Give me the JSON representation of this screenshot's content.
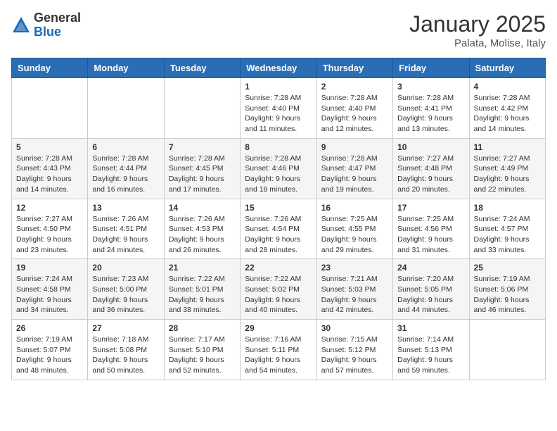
{
  "header": {
    "logo_general": "General",
    "logo_blue": "Blue",
    "month_title": "January 2025",
    "location": "Palata, Molise, Italy"
  },
  "days_of_week": [
    "Sunday",
    "Monday",
    "Tuesday",
    "Wednesday",
    "Thursday",
    "Friday",
    "Saturday"
  ],
  "weeks": [
    [
      {
        "day": "",
        "info": ""
      },
      {
        "day": "",
        "info": ""
      },
      {
        "day": "",
        "info": ""
      },
      {
        "day": "1",
        "info": "Sunrise: 7:28 AM\nSunset: 4:40 PM\nDaylight: 9 hours\nand 11 minutes."
      },
      {
        "day": "2",
        "info": "Sunrise: 7:28 AM\nSunset: 4:40 PM\nDaylight: 9 hours\nand 12 minutes."
      },
      {
        "day": "3",
        "info": "Sunrise: 7:28 AM\nSunset: 4:41 PM\nDaylight: 9 hours\nand 13 minutes."
      },
      {
        "day": "4",
        "info": "Sunrise: 7:28 AM\nSunset: 4:42 PM\nDaylight: 9 hours\nand 14 minutes."
      }
    ],
    [
      {
        "day": "5",
        "info": "Sunrise: 7:28 AM\nSunset: 4:43 PM\nDaylight: 9 hours\nand 14 minutes."
      },
      {
        "day": "6",
        "info": "Sunrise: 7:28 AM\nSunset: 4:44 PM\nDaylight: 9 hours\nand 16 minutes."
      },
      {
        "day": "7",
        "info": "Sunrise: 7:28 AM\nSunset: 4:45 PM\nDaylight: 9 hours\nand 17 minutes."
      },
      {
        "day": "8",
        "info": "Sunrise: 7:28 AM\nSunset: 4:46 PM\nDaylight: 9 hours\nand 18 minutes."
      },
      {
        "day": "9",
        "info": "Sunrise: 7:28 AM\nSunset: 4:47 PM\nDaylight: 9 hours\nand 19 minutes."
      },
      {
        "day": "10",
        "info": "Sunrise: 7:27 AM\nSunset: 4:48 PM\nDaylight: 9 hours\nand 20 minutes."
      },
      {
        "day": "11",
        "info": "Sunrise: 7:27 AM\nSunset: 4:49 PM\nDaylight: 9 hours\nand 22 minutes."
      }
    ],
    [
      {
        "day": "12",
        "info": "Sunrise: 7:27 AM\nSunset: 4:50 PM\nDaylight: 9 hours\nand 23 minutes."
      },
      {
        "day": "13",
        "info": "Sunrise: 7:26 AM\nSunset: 4:51 PM\nDaylight: 9 hours\nand 24 minutes."
      },
      {
        "day": "14",
        "info": "Sunrise: 7:26 AM\nSunset: 4:53 PM\nDaylight: 9 hours\nand 26 minutes."
      },
      {
        "day": "15",
        "info": "Sunrise: 7:26 AM\nSunset: 4:54 PM\nDaylight: 9 hours\nand 28 minutes."
      },
      {
        "day": "16",
        "info": "Sunrise: 7:25 AM\nSunset: 4:55 PM\nDaylight: 9 hours\nand 29 minutes."
      },
      {
        "day": "17",
        "info": "Sunrise: 7:25 AM\nSunset: 4:56 PM\nDaylight: 9 hours\nand 31 minutes."
      },
      {
        "day": "18",
        "info": "Sunrise: 7:24 AM\nSunset: 4:57 PM\nDaylight: 9 hours\nand 33 minutes."
      }
    ],
    [
      {
        "day": "19",
        "info": "Sunrise: 7:24 AM\nSunset: 4:58 PM\nDaylight: 9 hours\nand 34 minutes."
      },
      {
        "day": "20",
        "info": "Sunrise: 7:23 AM\nSunset: 5:00 PM\nDaylight: 9 hours\nand 36 minutes."
      },
      {
        "day": "21",
        "info": "Sunrise: 7:22 AM\nSunset: 5:01 PM\nDaylight: 9 hours\nand 38 minutes."
      },
      {
        "day": "22",
        "info": "Sunrise: 7:22 AM\nSunset: 5:02 PM\nDaylight: 9 hours\nand 40 minutes."
      },
      {
        "day": "23",
        "info": "Sunrise: 7:21 AM\nSunset: 5:03 PM\nDaylight: 9 hours\nand 42 minutes."
      },
      {
        "day": "24",
        "info": "Sunrise: 7:20 AM\nSunset: 5:05 PM\nDaylight: 9 hours\nand 44 minutes."
      },
      {
        "day": "25",
        "info": "Sunrise: 7:19 AM\nSunset: 5:06 PM\nDaylight: 9 hours\nand 46 minutes."
      }
    ],
    [
      {
        "day": "26",
        "info": "Sunrise: 7:19 AM\nSunset: 5:07 PM\nDaylight: 9 hours\nand 48 minutes."
      },
      {
        "day": "27",
        "info": "Sunrise: 7:18 AM\nSunset: 5:08 PM\nDaylight: 9 hours\nand 50 minutes."
      },
      {
        "day": "28",
        "info": "Sunrise: 7:17 AM\nSunset: 5:10 PM\nDaylight: 9 hours\nand 52 minutes."
      },
      {
        "day": "29",
        "info": "Sunrise: 7:16 AM\nSunset: 5:11 PM\nDaylight: 9 hours\nand 54 minutes."
      },
      {
        "day": "30",
        "info": "Sunrise: 7:15 AM\nSunset: 5:12 PM\nDaylight: 9 hours\nand 57 minutes."
      },
      {
        "day": "31",
        "info": "Sunrise: 7:14 AM\nSunset: 5:13 PM\nDaylight: 9 hours\nand 59 minutes."
      },
      {
        "day": "",
        "info": ""
      }
    ]
  ]
}
